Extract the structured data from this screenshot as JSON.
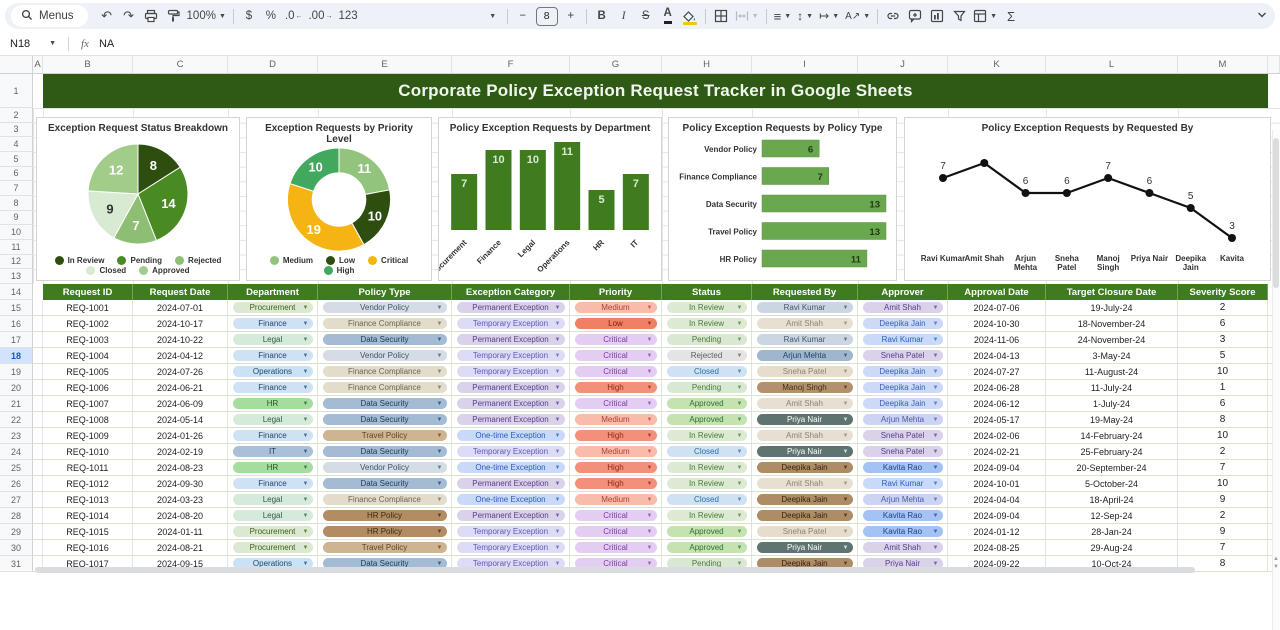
{
  "toolbar": {
    "menus": "Menus",
    "zoom": "100%",
    "currency": "$",
    "percent": "%",
    "decimal_decrease": ".0",
    "decimal_increase": ".00",
    "more_formats": "123",
    "font_size": "8",
    "minus": "−",
    "plus": "+",
    "bold": "B",
    "italic": "I",
    "strikethrough": "S",
    "text_color": "A",
    "text_rotation": "A",
    "functions": "Σ"
  },
  "formula_bar": {
    "cell_ref": "N18",
    "fx_label": "fx",
    "value": "NA"
  },
  "selection": {
    "selected_row_number": 18
  },
  "sheet": {
    "title": "Corporate Policy Exception Request Tracker in Google Sheets",
    "column_letters": [
      "A",
      "B",
      "C",
      "D",
      "E",
      "F",
      "G",
      "H",
      "I",
      "J",
      "K",
      "L",
      "M"
    ],
    "row_numbers": [
      1,
      2,
      3,
      4,
      5,
      6,
      7,
      8,
      9,
      10,
      11,
      12,
      13,
      14,
      15,
      16,
      17,
      18,
      19,
      20,
      21,
      22,
      23,
      24,
      25,
      26,
      27,
      28,
      29,
      30,
      31
    ]
  },
  "chart_data": [
    {
      "type": "pie",
      "title": "Exception Request Status Breakdown",
      "labels": [
        "In Review",
        "Pending",
        "Rejected",
        "Closed",
        "Approved"
      ],
      "values": [
        8,
        14,
        7,
        9,
        12
      ],
      "colors": [
        "#2d4e0f",
        "#4a8a23",
        "#8ebd74",
        "#d9ead3",
        "#a2cc8a"
      ],
      "legend_rows": [
        [
          "In Review",
          "Pending",
          "Rejected"
        ],
        [
          "Closed",
          "Approved"
        ]
      ]
    },
    {
      "type": "donut",
      "title": "Exception Requests by Priority Level",
      "labels": [
        "Medium",
        "Low",
        "Critical",
        "High"
      ],
      "values": [
        11,
        10,
        19,
        10
      ],
      "colors": [
        "#93c47d",
        "#2d4e0f",
        "#f5b414",
        "#41a85e"
      ],
      "legend_rows": [
        [
          "Medium",
          "Low",
          "Critical"
        ],
        [
          "High"
        ]
      ]
    },
    {
      "type": "bar",
      "title": "Policy Exception Requests by Department",
      "categories": [
        "Procurement",
        "Finance",
        "Legal",
        "Operations",
        "HR",
        "IT"
      ],
      "values": [
        7,
        10,
        10,
        11,
        5,
        7
      ],
      "bar_color": "#3e7c1f",
      "label_color": "#d9ead3"
    },
    {
      "type": "hbar",
      "title": "Policy Exception Requests by Policy Type",
      "categories": [
        "Vendor Policy",
        "Finance Compliance",
        "Data Security",
        "Travel Policy",
        "HR Policy"
      ],
      "values": [
        6,
        7,
        13,
        13,
        11
      ],
      "bar_color": "#6aa84f",
      "value_color": "#1e3a10"
    },
    {
      "type": "line",
      "title": "Policy Exception Requests by Requested By",
      "categories": [
        "Ravi Kumar",
        "Amit Shah",
        "Arjun\nMehta",
        "Sneha\nPatel",
        "Manoj\nSingh",
        "Priya Nair",
        "Deepika\nJain",
        "Kavita"
      ],
      "values": [
        7,
        8,
        6,
        6,
        7,
        6,
        5,
        3
      ],
      "value_labels": [
        "7",
        "",
        "6",
        "6",
        "7",
        "6",
        "5",
        "3"
      ],
      "line_color": "#111111"
    }
  ],
  "table": {
    "columns": [
      "Request ID",
      "Request Date",
      "Department",
      "Policy Type",
      "Exception Category",
      "Priority",
      "Status",
      "Requested By",
      "Approver",
      "Approval Date",
      "Target Closure Date",
      "Severity Score"
    ],
    "rows": [
      [
        "REQ-1001",
        "2024-07-01",
        "Procurement",
        "Vendor Policy",
        "Permanent Exception",
        "Medium",
        "In Review",
        "Ravi Kumar",
        "Amit Shah",
        "2024-07-06",
        "19-July-24",
        "2"
      ],
      [
        "REQ-1002",
        "2024-10-17",
        "Finance",
        "Finance Compliance",
        "Temporary Exception",
        "Low",
        "In Review",
        "Amit Shah",
        "Deepika Jain",
        "2024-10-30",
        "18-November-24",
        "6"
      ],
      [
        "REQ-1003",
        "2024-10-22",
        "Legal",
        "Data Security",
        "Permanent Exception",
        "Critical",
        "Pending",
        "Ravi Kumar",
        "Ravi Kumar",
        "2024-11-06",
        "24-November-24",
        "3"
      ],
      [
        "REQ-1004",
        "2024-04-12",
        "Finance",
        "Vendor Policy",
        "Temporary Exception",
        "Critical",
        "Rejected",
        "Arjun Mehta",
        "Sneha Patel",
        "2024-04-13",
        "3-May-24",
        "5"
      ],
      [
        "REQ-1005",
        "2024-07-26",
        "Operations",
        "Finance Compliance",
        "Temporary Exception",
        "Critical",
        "Closed",
        "Sneha Patel",
        "Deepika Jain",
        "2024-07-27",
        "11-August-24",
        "10"
      ],
      [
        "REQ-1006",
        "2024-06-21",
        "Finance",
        "Finance Compliance",
        "Permanent Exception",
        "High",
        "Pending",
        "Manoj Singh",
        "Deepika Jain",
        "2024-06-28",
        "11-July-24",
        "1"
      ],
      [
        "REQ-1007",
        "2024-06-09",
        "HR",
        "Data Security",
        "Permanent Exception",
        "Critical",
        "Approved",
        "Amit Shah",
        "Deepika Jain",
        "2024-06-12",
        "1-July-24",
        "6"
      ],
      [
        "REQ-1008",
        "2024-05-14",
        "Legal",
        "Data Security",
        "Permanent Exception",
        "Medium",
        "Approved",
        "Priya Nair",
        "Arjun Mehta",
        "2024-05-17",
        "19-May-24",
        "8"
      ],
      [
        "REQ-1009",
        "2024-01-26",
        "Finance",
        "Travel Policy",
        "One-time Exception",
        "High",
        "In Review",
        "Amit Shah",
        "Sneha Patel",
        "2024-02-06",
        "14-February-24",
        "10"
      ],
      [
        "REQ-1010",
        "2024-02-19",
        "IT",
        "Data Security",
        "Temporary Exception",
        "Medium",
        "Closed",
        "Priya Nair",
        "Sneha Patel",
        "2024-02-21",
        "25-February-24",
        "2"
      ],
      [
        "REQ-1011",
        "2024-08-23",
        "HR",
        "Vendor Policy",
        "One-time Exception",
        "High",
        "In Review",
        "Deepika Jain",
        "Kavita Rao",
        "2024-09-04",
        "20-September-24",
        "7"
      ],
      [
        "REQ-1012",
        "2024-09-30",
        "Finance",
        "Data Security",
        "Permanent Exception",
        "High",
        "In Review",
        "Amit Shah",
        "Ravi Kumar",
        "2024-10-01",
        "5-October-24",
        "10"
      ],
      [
        "REQ-1013",
        "2024-03-23",
        "Legal",
        "Finance Compliance",
        "One-time Exception",
        "Medium",
        "Closed",
        "Deepika Jain",
        "Arjun Mehta",
        "2024-04-04",
        "18-April-24",
        "9"
      ],
      [
        "REQ-1014",
        "2024-08-20",
        "Legal",
        "HR Policy",
        "Permanent Exception",
        "Critical",
        "In Review",
        "Deepika Jain",
        "Kavita Rao",
        "2024-09-04",
        "12-Sep-24",
        "2"
      ],
      [
        "REQ-1015",
        "2024-01-11",
        "Procurement",
        "HR Policy",
        "Temporary Exception",
        "Critical",
        "Approved",
        "Sneha Patel",
        "Kavita Rao",
        "2024-01-12",
        "28-Jan-24",
        "9"
      ],
      [
        "REQ-1016",
        "2024-08-21",
        "Procurement",
        "Travel Policy",
        "Temporary Exception",
        "Critical",
        "Approved",
        "Priya Nair",
        "Amit Shah",
        "2024-08-25",
        "29-Aug-24",
        "7"
      ],
      [
        "REQ-1017",
        "2024-09-15",
        "Operations",
        "Data Security",
        "Temporary Exception",
        "Critical",
        "Pending",
        "Deepika Jain",
        "Priya Nair",
        "2024-09-22",
        "10-Oct-24",
        "8"
      ]
    ],
    "palettes": {
      "department": {
        "Procurement": [
          "#dce9d2",
          "#3f6212"
        ],
        "Finance": [
          "#cfe2f3",
          "#26466d"
        ],
        "Legal": [
          "#d6ead9",
          "#2f5d44"
        ],
        "Operations": [
          "#c9e2f5",
          "#26466d"
        ],
        "HR": [
          "#a5dd9e",
          "#1d5e20"
        ],
        "IT": [
          "#a9c0d8",
          "#1d3e5e"
        ]
      },
      "policy": {
        "Vendor Policy": [
          "#d4dce6",
          "#44546a"
        ],
        "Finance Compliance": [
          "#e2dcca",
          "#6e6450"
        ],
        "Data Security": [
          "#a3bcd4",
          "#1d3a56"
        ],
        "Travel Policy": [
          "#ceb493",
          "#5c4620"
        ],
        "HR Policy": [
          "#b28d64",
          "#3d2a12"
        ]
      },
      "category": {
        "Permanent Exception": [
          "#d9d2e9",
          "#5b3d8a"
        ],
        "Temporary Exception": [
          "#dcdcf6",
          "#6158b0"
        ],
        "One-time Exception": [
          "#c9daf8",
          "#2a5cb8"
        ]
      },
      "priority": {
        "Medium": [
          "#f7bcab",
          "#b3402e"
        ],
        "Low": [
          "#ef8064",
          "#7a1f0a"
        ],
        "Critical": [
          "#e4cdf2",
          "#7d3f9e"
        ],
        "High": [
          "#f2907b",
          "#8f2616"
        ]
      },
      "status": {
        "In Review": [
          "#dcead3",
          "#4d7a3a"
        ],
        "Pending": [
          "#d9e8d2",
          "#4d7a3a"
        ],
        "Rejected": [
          "#e4e4e4",
          "#5f5f5f"
        ],
        "Closed": [
          "#cfe2f3",
          "#2e6da4"
        ],
        "Approved": [
          "#c4e2b2",
          "#2e7031"
        ]
      },
      "requested_by": {
        "Ravi Kumar": [
          "#ccd6e2",
          "#44546a"
        ],
        "Amit Shah": [
          "#e6e0d2",
          "#8c8474"
        ],
        "Arjun Mehta": [
          "#9fb6cd",
          "#22456b"
        ],
        "Sneha Patel": [
          "#e6ddcd",
          "#8c8270"
        ],
        "Manoj Singh": [
          "#b4916e",
          "#40301a"
        ],
        "Priya Nair": [
          "#5f7370",
          "#ffffff"
        ],
        "Deepika Jain": [
          "#ad8c66",
          "#362611"
        ]
      },
      "approver": {
        "Amit Shah": [
          "#d9d2e9",
          "#5b3d8a"
        ],
        "Deepika Jain": [
          "#ccd9f7",
          "#3b63b8"
        ],
        "Ravi Kumar": [
          "#c9daf8",
          "#2a5cb8"
        ],
        "Sneha Patel": [
          "#d9d2e9",
          "#5b3d8a"
        ],
        "Arjun Mehta": [
          "#ccd4f2",
          "#4f55b0"
        ],
        "Kavita Rao": [
          "#a4c2f4",
          "#1c4587"
        ],
        "Priya Nair": [
          "#d9d2e9",
          "#5b3d8a"
        ]
      }
    }
  }
}
